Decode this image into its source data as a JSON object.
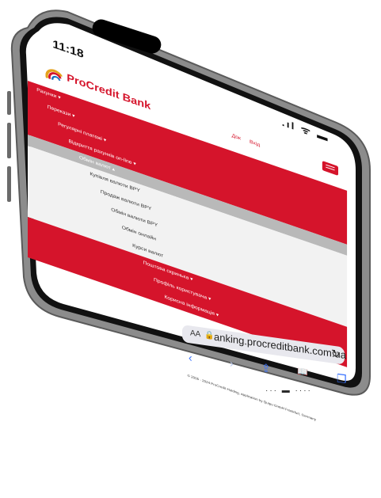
{
  "status": {
    "time": "11:18",
    "icons": ".ıl ᯤ ▬"
  },
  "header": {
    "logo": "ProCredit Bank",
    "link_docs": "Док",
    "link_login": "Вхід"
  },
  "menu": {
    "top_items": [
      "Рахунки",
      "Перекази",
      "Регулярні платежі",
      "Відкриття рахунків on-line"
    ],
    "expanded": "Обмін валют",
    "sub_items": [
      "Купівля валюти BPY",
      "Продаж валюти BPY",
      "Обмін валюти BPY",
      "Обмін онлайн",
      "Курси валют"
    ],
    "bottom_items": [
      "Поштова скринька",
      "Профіль користувача",
      "Корисна інформація"
    ]
  },
  "footer": "© 2005 - 2024 ProCredit Holding, application by Quipu GmbH Frankfurt, Germany",
  "browser": {
    "aa": "AA",
    "url": "anking.procreditbank.com.ua",
    "reload_icon": "↻",
    "back_icon": "‹",
    "forward_icon": "›",
    "share_icon": "⇪",
    "bookmarks_icon": "📖",
    "tabs_icon": "❐"
  },
  "home": "··· ▬ ····",
  "colors": {
    "accent": "#d5142b",
    "gray": "#b9b9b9",
    "link_blue": "#3a73ff"
  }
}
